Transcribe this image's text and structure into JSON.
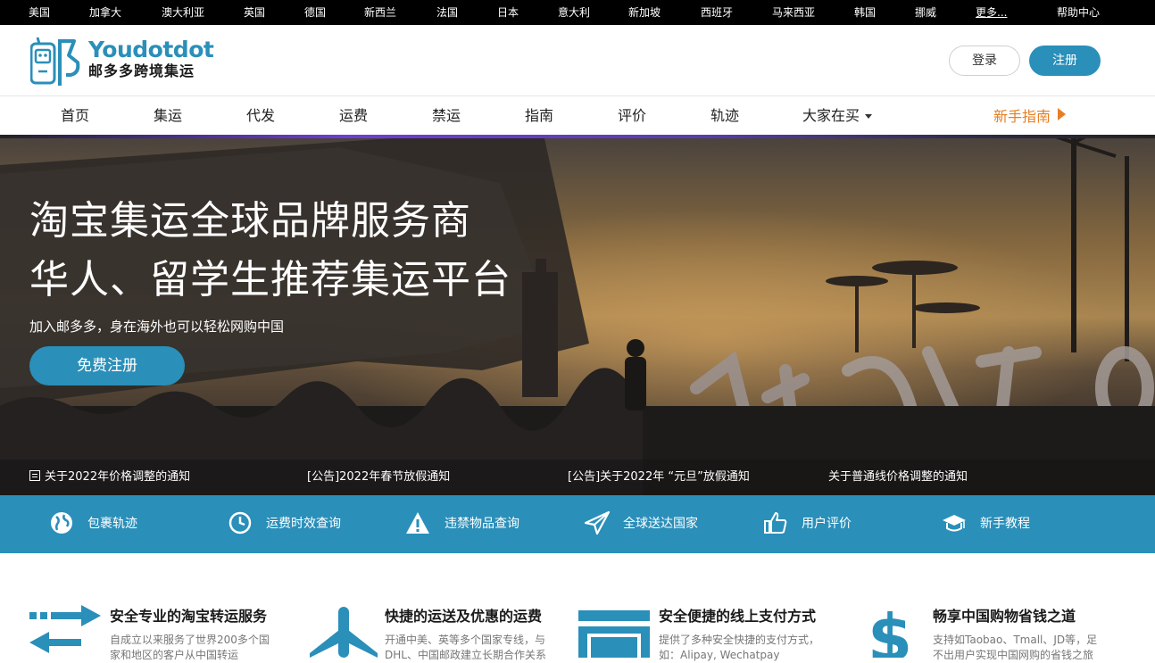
{
  "countries": [
    "美国",
    "加拿大",
    "澳大利亚",
    "英国",
    "德国",
    "新西兰",
    "法国",
    "日本",
    "意大利",
    "新加坡",
    "西班牙",
    "马来西亚",
    "韩国",
    "挪威"
  ],
  "more_label": "更多...",
  "help_label": "帮助中心",
  "brand": {
    "name": "Youdotdot",
    "tagline": "邮多多跨境集运",
    "color": "#2a8fb9"
  },
  "auth": {
    "login": "登录",
    "register": "注册"
  },
  "nav": {
    "items": [
      "首页",
      "集运",
      "代发",
      "运费",
      "禁运",
      "指南",
      "评价",
      "轨迹"
    ],
    "dropdown": "大家在买",
    "guide": "新手指南",
    "guide_color": "#e67e22"
  },
  "hero": {
    "title_line1": "淘宝集运全球品牌服务商",
    "title_line2": "华人、留学生推荐集运平台",
    "subtitle": "加入邮多多，身在海外也可以轻松网购中国",
    "cta": "免费注册",
    "notices": [
      "关于2022年价格调整的通知",
      "[公告]2022年春节放假通知",
      "[公告]关于2022年 “元旦”放假通知",
      "关于普通线价格调整的通知"
    ]
  },
  "features": [
    {
      "label": "包裹轨迹",
      "icon": "globe-icon"
    },
    {
      "label": "运费时效查询",
      "icon": "clock-icon"
    },
    {
      "label": "违禁物品查询",
      "icon": "warning-icon"
    },
    {
      "label": "全球送达国家",
      "icon": "paper-plane-icon"
    },
    {
      "label": "用户评价",
      "icon": "thumbs-up-icon"
    },
    {
      "label": "新手教程",
      "icon": "graduation-cap-icon"
    }
  ],
  "cards": [
    {
      "title": "安全专业的淘宝转运服务",
      "desc": "自成立以来服务了世界200多个国家和地区的客户从中国转运",
      "icon": "transfer-arrows-icon"
    },
    {
      "title": "快捷的运送及优惠的运费",
      "desc": "开通中美、英等多个国家专线，与DHL、中国邮政建立长期合作关系",
      "icon": "airplane-icon"
    },
    {
      "title": "安全便捷的线上支付方式",
      "desc": "提供了多种安全快捷的支付方式，如：Alipay, Wechatpay",
      "icon": "credit-card-icon"
    },
    {
      "title": "畅享中国购物省钱之道",
      "desc": "支持如Taobao、Tmall、JD等，足不出用户实现中国网购的省钱之旅",
      "icon": "dollar-icon"
    }
  ]
}
